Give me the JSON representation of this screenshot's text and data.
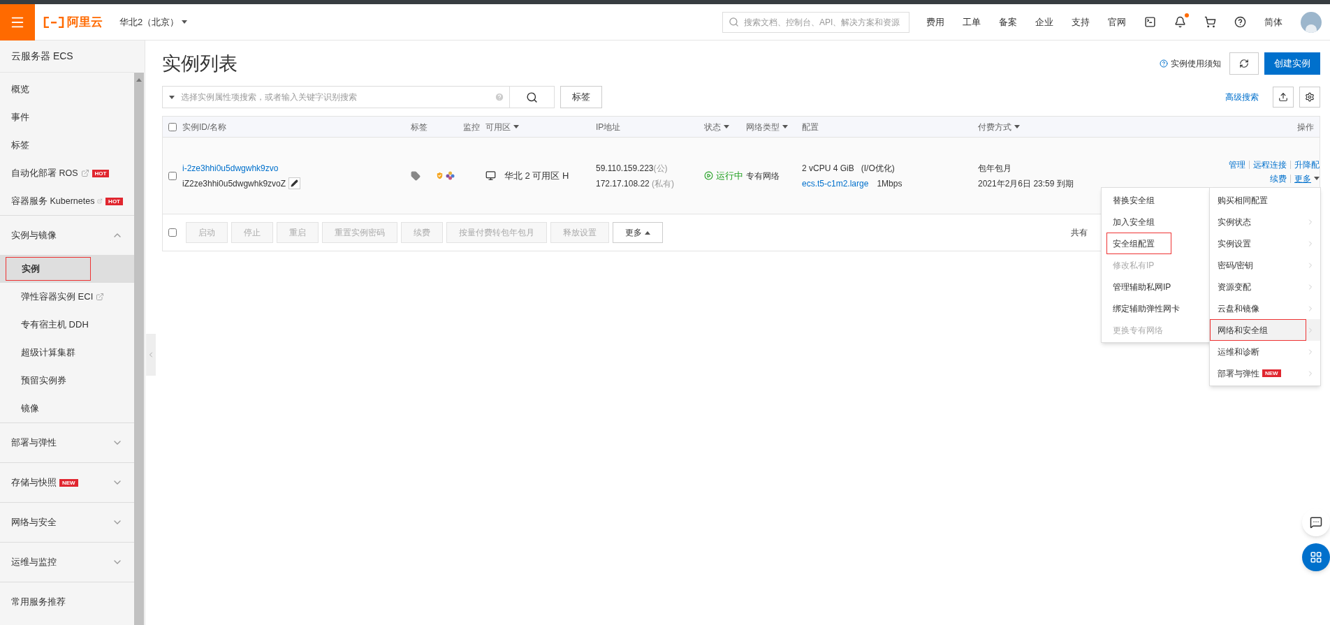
{
  "topbar": {
    "brand": "阿里云",
    "region": "华北2（北京）",
    "search_placeholder": "搜索文档、控制台、API、解决方案和资源",
    "links": [
      "费用",
      "工单",
      "备案",
      "企业",
      "支持",
      "官网"
    ],
    "notification_dot": true,
    "language": "简体"
  },
  "sidebar": {
    "title": "云服务器 ECS",
    "items": [
      {
        "kind": "link",
        "label": "概览",
        "external": false,
        "selected": false
      },
      {
        "kind": "link",
        "label": "事件",
        "external": false,
        "selected": false
      },
      {
        "kind": "link",
        "label": "标签",
        "external": false,
        "selected": false
      },
      {
        "kind": "link",
        "label": "自动化部署 ROS",
        "external": true,
        "badge": "HOT",
        "selected": false
      },
      {
        "kind": "link",
        "label": "容器服务 Kubernetes",
        "external": true,
        "badge": "HOT",
        "selected": false
      },
      {
        "kind": "group",
        "label": "实例与镜像",
        "expanded": true,
        "children": [
          {
            "label": "实例",
            "external": false,
            "selected": true,
            "outlined": true
          },
          {
            "label": "弹性容器实例 ECI",
            "external": true,
            "selected": false,
            "outlined": false
          },
          {
            "label": "专有宿主机 DDH",
            "external": false,
            "selected": false,
            "outlined": false
          },
          {
            "label": "超级计算集群",
            "external": false,
            "selected": false,
            "outlined": false
          },
          {
            "label": "预留实例券",
            "external": false,
            "selected": false,
            "outlined": false
          },
          {
            "label": "镜像",
            "external": false,
            "selected": false,
            "outlined": false
          }
        ]
      },
      {
        "kind": "group",
        "label": "部署与弹性",
        "expanded": false
      },
      {
        "kind": "group",
        "label": "存储与快照",
        "badge": "NEW",
        "expanded": false
      },
      {
        "kind": "group",
        "label": "网络与安全",
        "expanded": false
      },
      {
        "kind": "group",
        "label": "运维与监控",
        "expanded": false
      },
      {
        "kind": "heading",
        "label": "常用服务推荐"
      }
    ]
  },
  "page": {
    "title": "实例列表",
    "notice_link": "实例使用须知",
    "create_button": "创建实例",
    "search_placeholder": "选择实例属性项搜索，或者输入关键字识别搜索",
    "tag_button": "标签",
    "advanced_search": "高级搜索"
  },
  "table": {
    "header_checked": false,
    "columns": [
      {
        "label": "实例ID/名称",
        "sortable": false
      },
      {
        "label": "标签",
        "sortable": false
      },
      {
        "label": "监控",
        "sortable": false
      },
      {
        "label": "可用区",
        "sortable": true
      },
      {
        "label": "IP地址",
        "sortable": false
      },
      {
        "label": "状态",
        "sortable": true
      },
      {
        "label": "网络类型",
        "sortable": true
      },
      {
        "label": "配置",
        "sortable": false
      },
      {
        "label": "付费方式",
        "sortable": true
      },
      {
        "label": "操作",
        "sortable": false
      }
    ],
    "rows": [
      {
        "checked": false,
        "id": "i-2ze3hhi0u5dwgwhk9zvo",
        "name": "iZ2ze3hhi0u5dwgwhk9zvoZ",
        "zone": "华北 2 可用区 H",
        "public_ip": "59.110.159.223",
        "public_tag": "(公)",
        "private_ip": "172.17.108.22",
        "private_tag": "(私有)",
        "status": "运行中",
        "network": "专有网络",
        "spec": "2 vCPU 4 GiB",
        "spec_note": "(I/O优化)",
        "instance_type": "ecs.t5-c1m2.large",
        "bandwidth": "1Mbps",
        "billing": "包年包月",
        "expiry": "2021年2月6日 23:59 到期",
        "actions": [
          "管理",
          "远程连接",
          "升降配",
          "续费",
          "更多"
        ]
      }
    ],
    "batch_actions": [
      {
        "label": "启动",
        "disabled": true
      },
      {
        "label": "停止",
        "disabled": true
      },
      {
        "label": "重启",
        "disabled": true
      },
      {
        "label": "重置实例密码",
        "disabled": true
      },
      {
        "label": "续费",
        "disabled": true
      },
      {
        "label": "按量付费转包年包月",
        "disabled": true
      },
      {
        "label": "释放设置",
        "disabled": true
      },
      {
        "label": "更多",
        "disabled": false
      }
    ],
    "batch_checked": false,
    "total_partial": "共有"
  },
  "more_menu": {
    "items": [
      {
        "label": "购买相同配置",
        "submenu": false,
        "selected": false,
        "outlined": false
      },
      {
        "label": "实例状态",
        "submenu": true,
        "selected": false,
        "outlined": false
      },
      {
        "label": "实例设置",
        "submenu": true,
        "selected": false,
        "outlined": false
      },
      {
        "label": "密码/密钥",
        "submenu": true,
        "selected": false,
        "outlined": false
      },
      {
        "label": "资源变配",
        "submenu": true,
        "selected": false,
        "outlined": false
      },
      {
        "label": "云盘和镜像",
        "submenu": true,
        "selected": false,
        "outlined": false
      },
      {
        "label": "网络和安全组",
        "submenu": true,
        "selected": true,
        "outlined": true
      },
      {
        "label": "运维和诊断",
        "submenu": true,
        "selected": false,
        "outlined": false
      },
      {
        "label": "部署与弹性",
        "submenu": true,
        "badge": "NEW",
        "selected": false,
        "outlined": false
      }
    ]
  },
  "submenu": {
    "items": [
      {
        "label": "替换安全组",
        "disabled": false,
        "outlined": false
      },
      {
        "label": "加入安全组",
        "disabled": false,
        "outlined": false
      },
      {
        "label": "安全组配置",
        "disabled": false,
        "outlined": true
      },
      {
        "label": "修改私有IP",
        "disabled": true,
        "outlined": false
      },
      {
        "label": "管理辅助私网IP",
        "disabled": false,
        "outlined": false
      },
      {
        "label": "绑定辅助弹性网卡",
        "disabled": false,
        "outlined": false
      },
      {
        "label": "更换专有网络",
        "disabled": true,
        "outlined": false
      }
    ]
  }
}
